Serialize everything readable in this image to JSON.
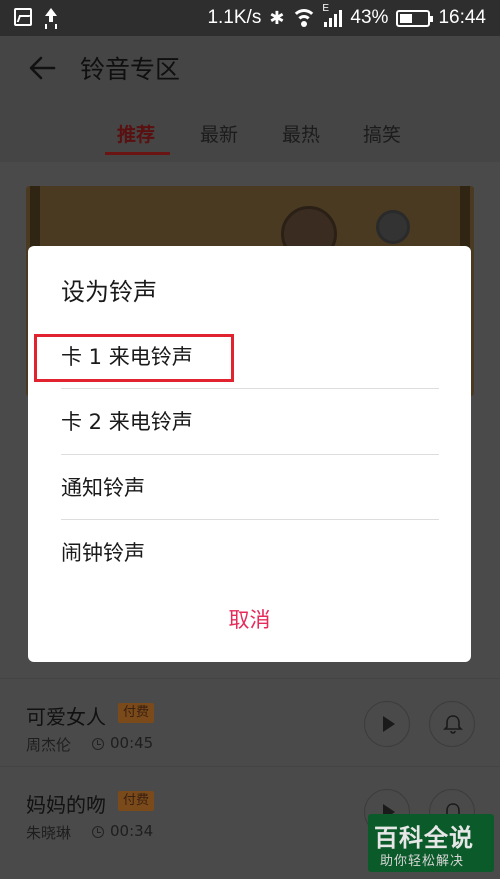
{
  "status_bar": {
    "network_speed": "1.1K/s",
    "signal_label": "E",
    "battery_percent": "43%",
    "time": "16:44",
    "icons": [
      "image-icon",
      "upload-icon",
      "bluetooth-icon",
      "wifi-icon",
      "signal-icon",
      "battery-icon"
    ]
  },
  "header": {
    "title": "铃音专区",
    "back_icon": "back-arrow-icon"
  },
  "tabs": [
    {
      "label": "推荐",
      "active": true
    },
    {
      "label": "最新",
      "active": false
    },
    {
      "label": "最热",
      "active": false
    },
    {
      "label": "搞笑",
      "active": false
    }
  ],
  "songs": [
    {
      "name": "可爱女人",
      "badge": "付费",
      "artist": "周杰伦",
      "duration": "00:45"
    },
    {
      "name": "妈妈的吻",
      "badge": "付费",
      "artist": "朱晓琳",
      "duration": "00:34"
    }
  ],
  "dialog": {
    "title": "设为铃声",
    "options": [
      "卡 1 来电铃声",
      "卡 2 来电铃声",
      "通知铃声",
      "闹钟铃声"
    ],
    "highlighted_option_index": 0,
    "cancel_label": "取消"
  },
  "watermark": {
    "title": "百科全说",
    "subtitle": "助你轻松解决"
  },
  "colors": {
    "accent": "#e62a5a",
    "highlight_box": "#e0232f",
    "badge": "#f39c3a",
    "watermark_bg": "#0b5a2a"
  }
}
